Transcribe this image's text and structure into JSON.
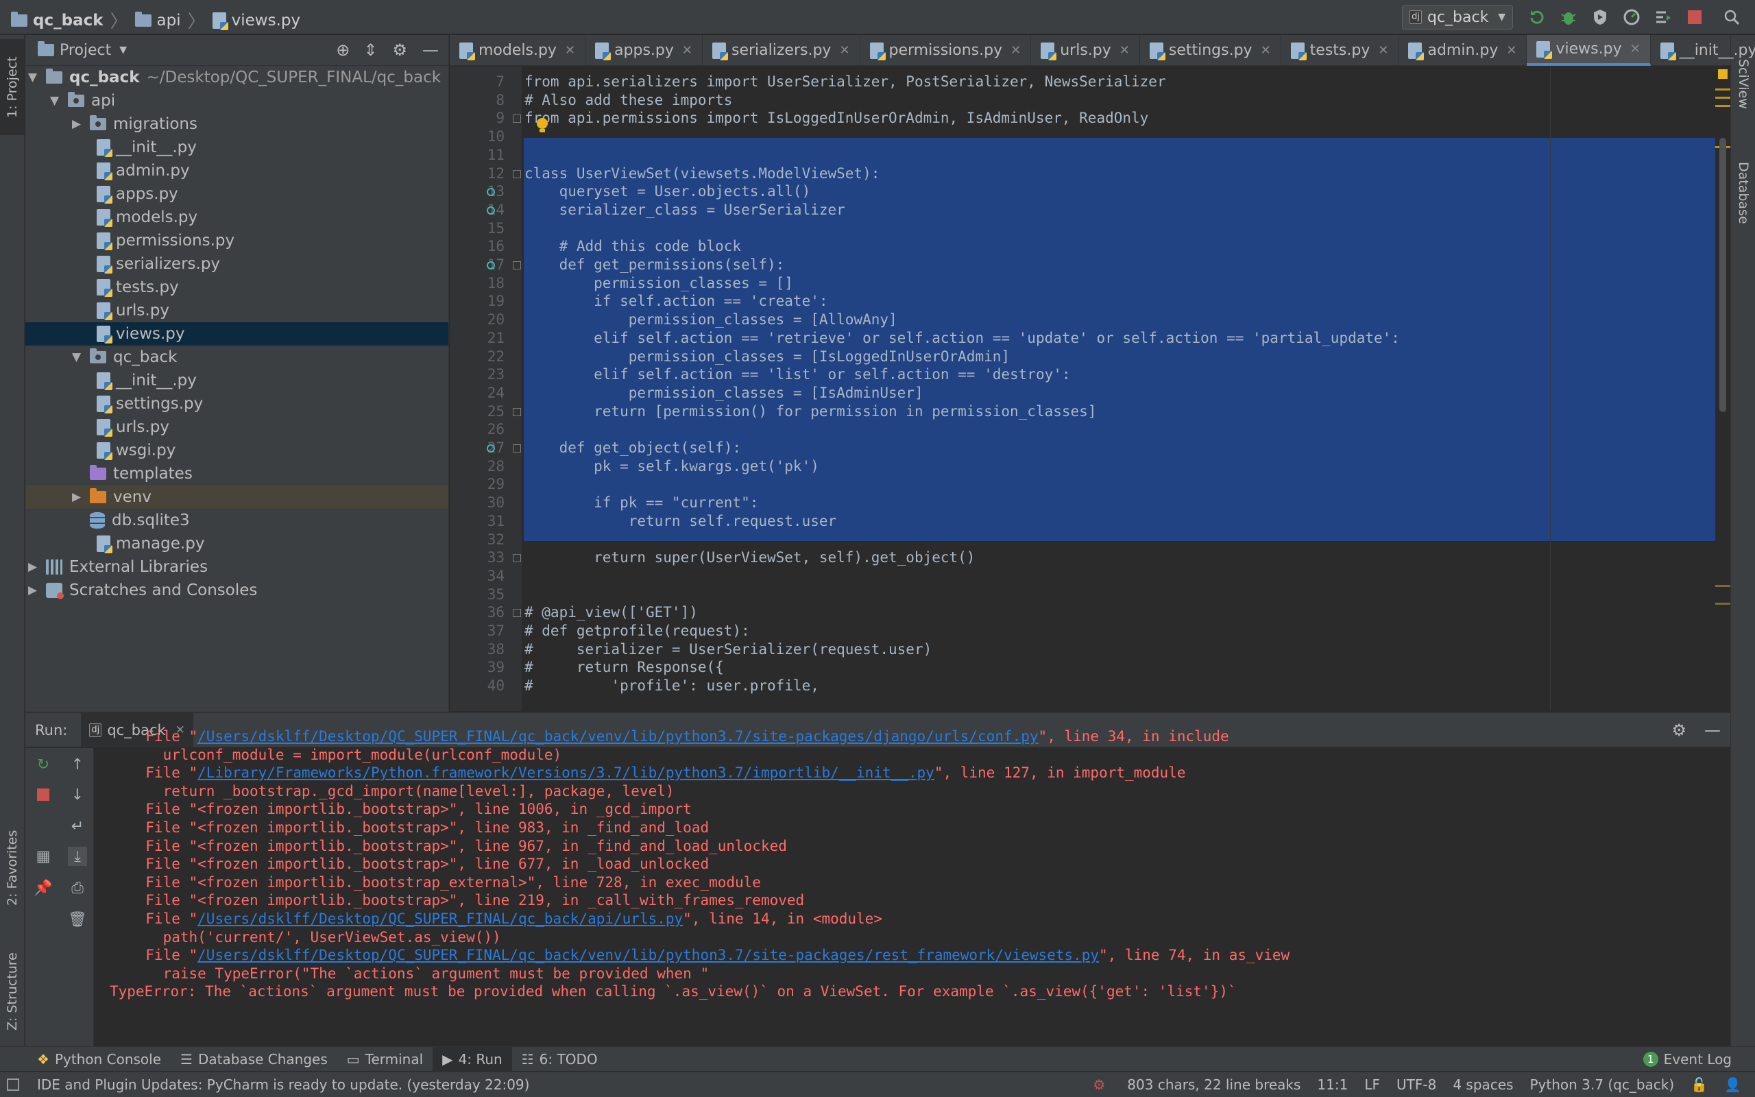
{
  "titlebar": {
    "breadcrumb": [
      "qc_back",
      "api",
      "views.py"
    ],
    "run_config": "qc_back"
  },
  "left_strip": {
    "project_tab": "1: Project",
    "favorites_tab": "2: Favorites",
    "structure_tab": "Z: Structure"
  },
  "right_strip": {
    "sciview_tab": "SciView",
    "database_tab": "Database"
  },
  "project": {
    "title": "Project",
    "root_name": "qc_back",
    "root_path": "~/Desktop/QC_SUPER_FINAL/qc_back",
    "items": [
      {
        "label": "api"
      },
      {
        "label": "migrations"
      },
      {
        "label": "__init__.py"
      },
      {
        "label": "admin.py"
      },
      {
        "label": "apps.py"
      },
      {
        "label": "models.py"
      },
      {
        "label": "permissions.py"
      },
      {
        "label": "serializers.py"
      },
      {
        "label": "tests.py"
      },
      {
        "label": "urls.py"
      },
      {
        "label": "views.py"
      },
      {
        "label": "qc_back"
      },
      {
        "label": "__init__.py"
      },
      {
        "label": "settings.py"
      },
      {
        "label": "urls.py"
      },
      {
        "label": "wsgi.py"
      },
      {
        "label": "templates"
      },
      {
        "label": "venv"
      },
      {
        "label": "db.sqlite3"
      },
      {
        "label": "manage.py"
      },
      {
        "label": "External Libraries"
      },
      {
        "label": "Scratches and Consoles"
      }
    ]
  },
  "tabs": [
    {
      "label": "models.py"
    },
    {
      "label": "apps.py"
    },
    {
      "label": "serializers.py"
    },
    {
      "label": "permissions.py"
    },
    {
      "label": "urls.py"
    },
    {
      "label": "settings.py"
    },
    {
      "label": "tests.py"
    },
    {
      "label": "admin.py"
    },
    {
      "label": "views.py"
    },
    {
      "label": "__init__.py"
    }
  ],
  "editor": {
    "line_numbers": [
      "7",
      "8",
      "9",
      "10",
      "11",
      "12",
      "13",
      "14",
      "15",
      "16",
      "17",
      "18",
      "19",
      "20",
      "21",
      "22",
      "23",
      "24",
      "25",
      "26",
      "27",
      "28",
      "29",
      "30",
      "31",
      "32",
      "33",
      "34",
      "35",
      "36",
      "37",
      "38",
      "39",
      "40"
    ],
    "lines": [
      "from api.serializers import UserSerializer, PostSerializer, NewsSerializer",
      "# Also add these imports",
      "from api.permissions import IsLoggedInUserOrAdmin, IsAdminUser, ReadOnly",
      "",
      "",
      "class UserViewSet(viewsets.ModelViewSet):",
      "    queryset = User.objects.all()",
      "    serializer_class = UserSerializer",
      "",
      "    # Add this code block",
      "    def get_permissions(self):",
      "        permission_classes = []",
      "        if self.action == 'create':",
      "            permission_classes = [AllowAny]",
      "        elif self.action == 'retrieve' or self.action == 'update' or self.action == 'partial_update':",
      "            permission_classes = [IsLoggedInUserOrAdmin]",
      "        elif self.action == 'list' or self.action == 'destroy':",
      "            permission_classes = [IsAdminUser]",
      "        return [permission() for permission in permission_classes]",
      "",
      "    def get_object(self):",
      "        pk = self.kwargs.get('pk')",
      "",
      "        if pk == \"current\":",
      "            return self.request.user",
      "",
      "        return super(UserViewSet, self).get_object()",
      "",
      "",
      "# @api_view(['GET'])",
      "# def getprofile(request):",
      "#     serializer = UserSerializer(request.user)",
      "#     return Response({",
      "#         'profile': user.profile,"
    ]
  },
  "run": {
    "label": "Run:",
    "tab": "qc_back",
    "lines": [
      {
        "pre": "  File \"",
        "link": "/Users/dsklff/Desktop/QC_SUPER_FINAL/qc_back/venv/lib/python3.7/site-packages/django/urls/conf.py",
        "post": "\", line 34, in include"
      },
      {
        "pre": "    urlconf_module = import_module(urlconf_module)",
        "link": "",
        "post": ""
      },
      {
        "pre": "  File \"",
        "link": "/Library/Frameworks/Python.framework/Versions/3.7/lib/python3.7/importlib/__init__.py",
        "post": "\", line 127, in import_module"
      },
      {
        "pre": "    return _bootstrap._gcd_import(name[level:], package, level)",
        "link": "",
        "post": ""
      },
      {
        "pre": "  File \"<frozen importlib._bootstrap>\", line 1006, in _gcd_import",
        "link": "",
        "post": ""
      },
      {
        "pre": "  File \"<frozen importlib._bootstrap>\", line 983, in _find_and_load",
        "link": "",
        "post": ""
      },
      {
        "pre": "  File \"<frozen importlib._bootstrap>\", line 967, in _find_and_load_unlocked",
        "link": "",
        "post": ""
      },
      {
        "pre": "  File \"<frozen importlib._bootstrap>\", line 677, in _load_unlocked",
        "link": "",
        "post": ""
      },
      {
        "pre": "  File \"<frozen importlib._bootstrap_external>\", line 728, in exec_module",
        "link": "",
        "post": ""
      },
      {
        "pre": "  File \"<frozen importlib._bootstrap>\", line 219, in _call_with_frames_removed",
        "link": "",
        "post": ""
      },
      {
        "pre": "  File \"",
        "link": "/Users/dsklff/Desktop/QC_SUPER_FINAL/qc_back/api/urls.py",
        "post": "\", line 14, in <module>"
      },
      {
        "pre": "    path('current/', UserViewSet.as_view())",
        "link": "",
        "post": ""
      },
      {
        "pre": "  File \"",
        "link": "/Users/dsklff/Desktop/QC_SUPER_FINAL/qc_back/venv/lib/python3.7/site-packages/rest_framework/viewsets.py",
        "post": "\", line 74, in as_view"
      },
      {
        "pre": "    raise TypeError(\"The `actions` argument must be provided when \"",
        "link": "",
        "post": ""
      },
      {
        "pre": "TypeError: The `actions` argument must be provided when calling `.as_view()` on a ViewSet. For example `.as_view({'get': 'list'})`",
        "link": "",
        "post": ""
      }
    ]
  },
  "bottom_tools": [
    {
      "label": "Python Console"
    },
    {
      "label": "Database Changes"
    },
    {
      "label": "Terminal"
    },
    {
      "label": "4: Run"
    },
    {
      "label": "6: TODO"
    }
  ],
  "event_log": {
    "count": "1",
    "label": "Event Log"
  },
  "status": {
    "message": "IDE and Plugin Updates: PyCharm is ready to update. (yesterday 22:09)",
    "chars": "803 chars, 22 line breaks",
    "position": "11:1",
    "line_sep": "LF",
    "encoding": "UTF-8",
    "indent": "4 spaces",
    "interpreter": "Python 3.7 (qc_back)"
  },
  "colors": {
    "accent": "#4a88c7",
    "selection": "#214283",
    "error": "#ff6b68",
    "link": "#287bde"
  }
}
